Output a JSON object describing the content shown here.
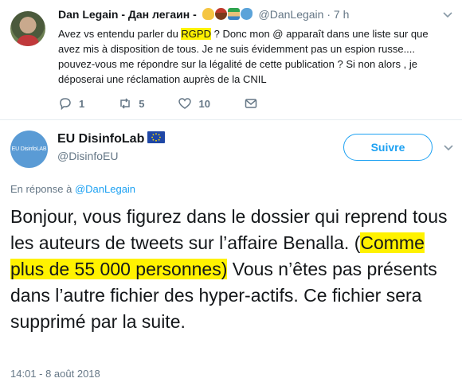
{
  "reply_tweet": {
    "author_name": "Dan Legain - Дан легаин -",
    "emoji_icons": [
      "flexed-bicep-icon",
      "drum-icon",
      "island-icon",
      "whale-icon"
    ],
    "handle": "@DanLegain",
    "separator": "·",
    "time": "7 h",
    "text_before": "Avez vs entendu parler du ",
    "text_highlight": "RGPD",
    "text_after": " ? Donc mon @ apparaît dans une liste sur que avez mis à disposition de tous. Je ne suis évidemment pas un espion russe.... pouvez-vous me répondre sur la légalité de cette publication ? Si  non alors , je déposerai une réclamation auprès de la CNIL",
    "actions": {
      "reply_count": "1",
      "retweet_count": "5",
      "like_count": "10"
    }
  },
  "main_tweet": {
    "author_name": "EU DisinfoLab",
    "avatar_text": "EU DisinfoLAB",
    "handle": "@DisinfoEU",
    "follow_label": "Suivre",
    "reply_to_prefix": "En réponse à ",
    "reply_to_handle": "@DanLegain",
    "text_before": "Bonjour, vous figurez dans le dossier qui reprend tous les auteurs de tweets sur l’affaire Benalla. (",
    "text_highlight": "Comme plus de 55 000 personnes)",
    "text_after": " Vous n’êtes pas présents dans l’autre fichier des hyper-actifs. Ce fichier sera supprimé par la suite.",
    "timestamp": "14:01 - 8 août 2018"
  },
  "colors": {
    "accent": "#1da1f2",
    "highlight": "#fff200",
    "muted": "#657786",
    "text": "#14171a"
  }
}
